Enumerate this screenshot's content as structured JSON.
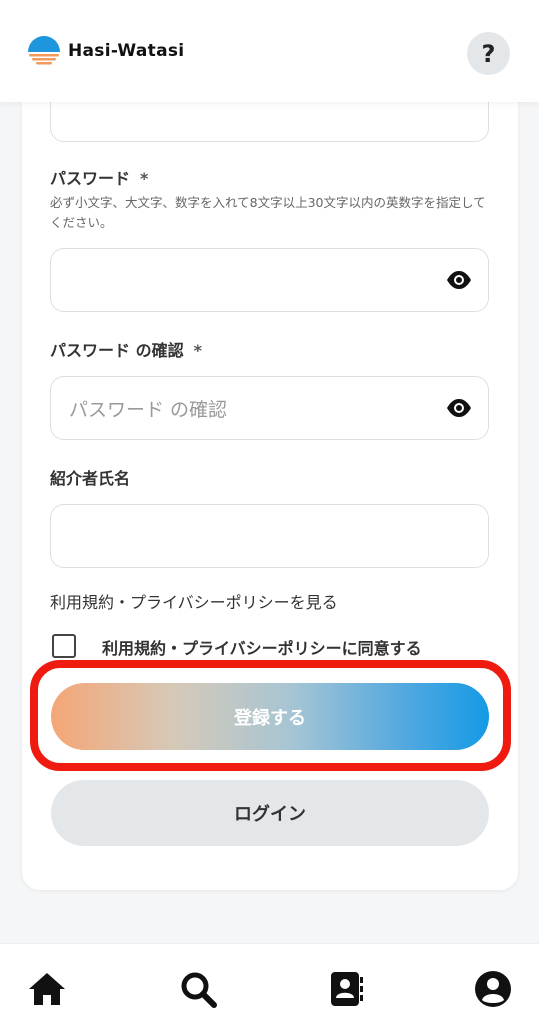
{
  "header": {
    "app_name": "Hasi-Watasi",
    "help_label": "?"
  },
  "form": {
    "password": {
      "label": "パスワード",
      "required_mark": "*",
      "hint": "必ず小文字、大文字、数字を入れて8文字以上30文字以内の英数字を指定してください。",
      "value": ""
    },
    "password_confirm": {
      "label": "パスワード の確認",
      "required_mark": "*",
      "placeholder": "パスワード の確認",
      "value": ""
    },
    "referrer": {
      "label": "紹介者氏名",
      "value": ""
    },
    "terms_link": "利用規約・プライバシーポリシーを見る",
    "agree_label": "利用規約・プライバシーポリシーに同意する",
    "agree_checked": false,
    "register_button": "登録する",
    "login_button": "ログイン"
  },
  "bottom_nav": {
    "items": [
      {
        "icon": "home-icon"
      },
      {
        "icon": "search-icon"
      },
      {
        "icon": "contacts-book-icon"
      },
      {
        "icon": "profile-icon"
      }
    ]
  },
  "colors": {
    "highlight_border": "#f01b10",
    "register_gradient_start": "#f4a676",
    "register_gradient_end": "#149ae6",
    "secondary_button": "#e4e7ea"
  }
}
